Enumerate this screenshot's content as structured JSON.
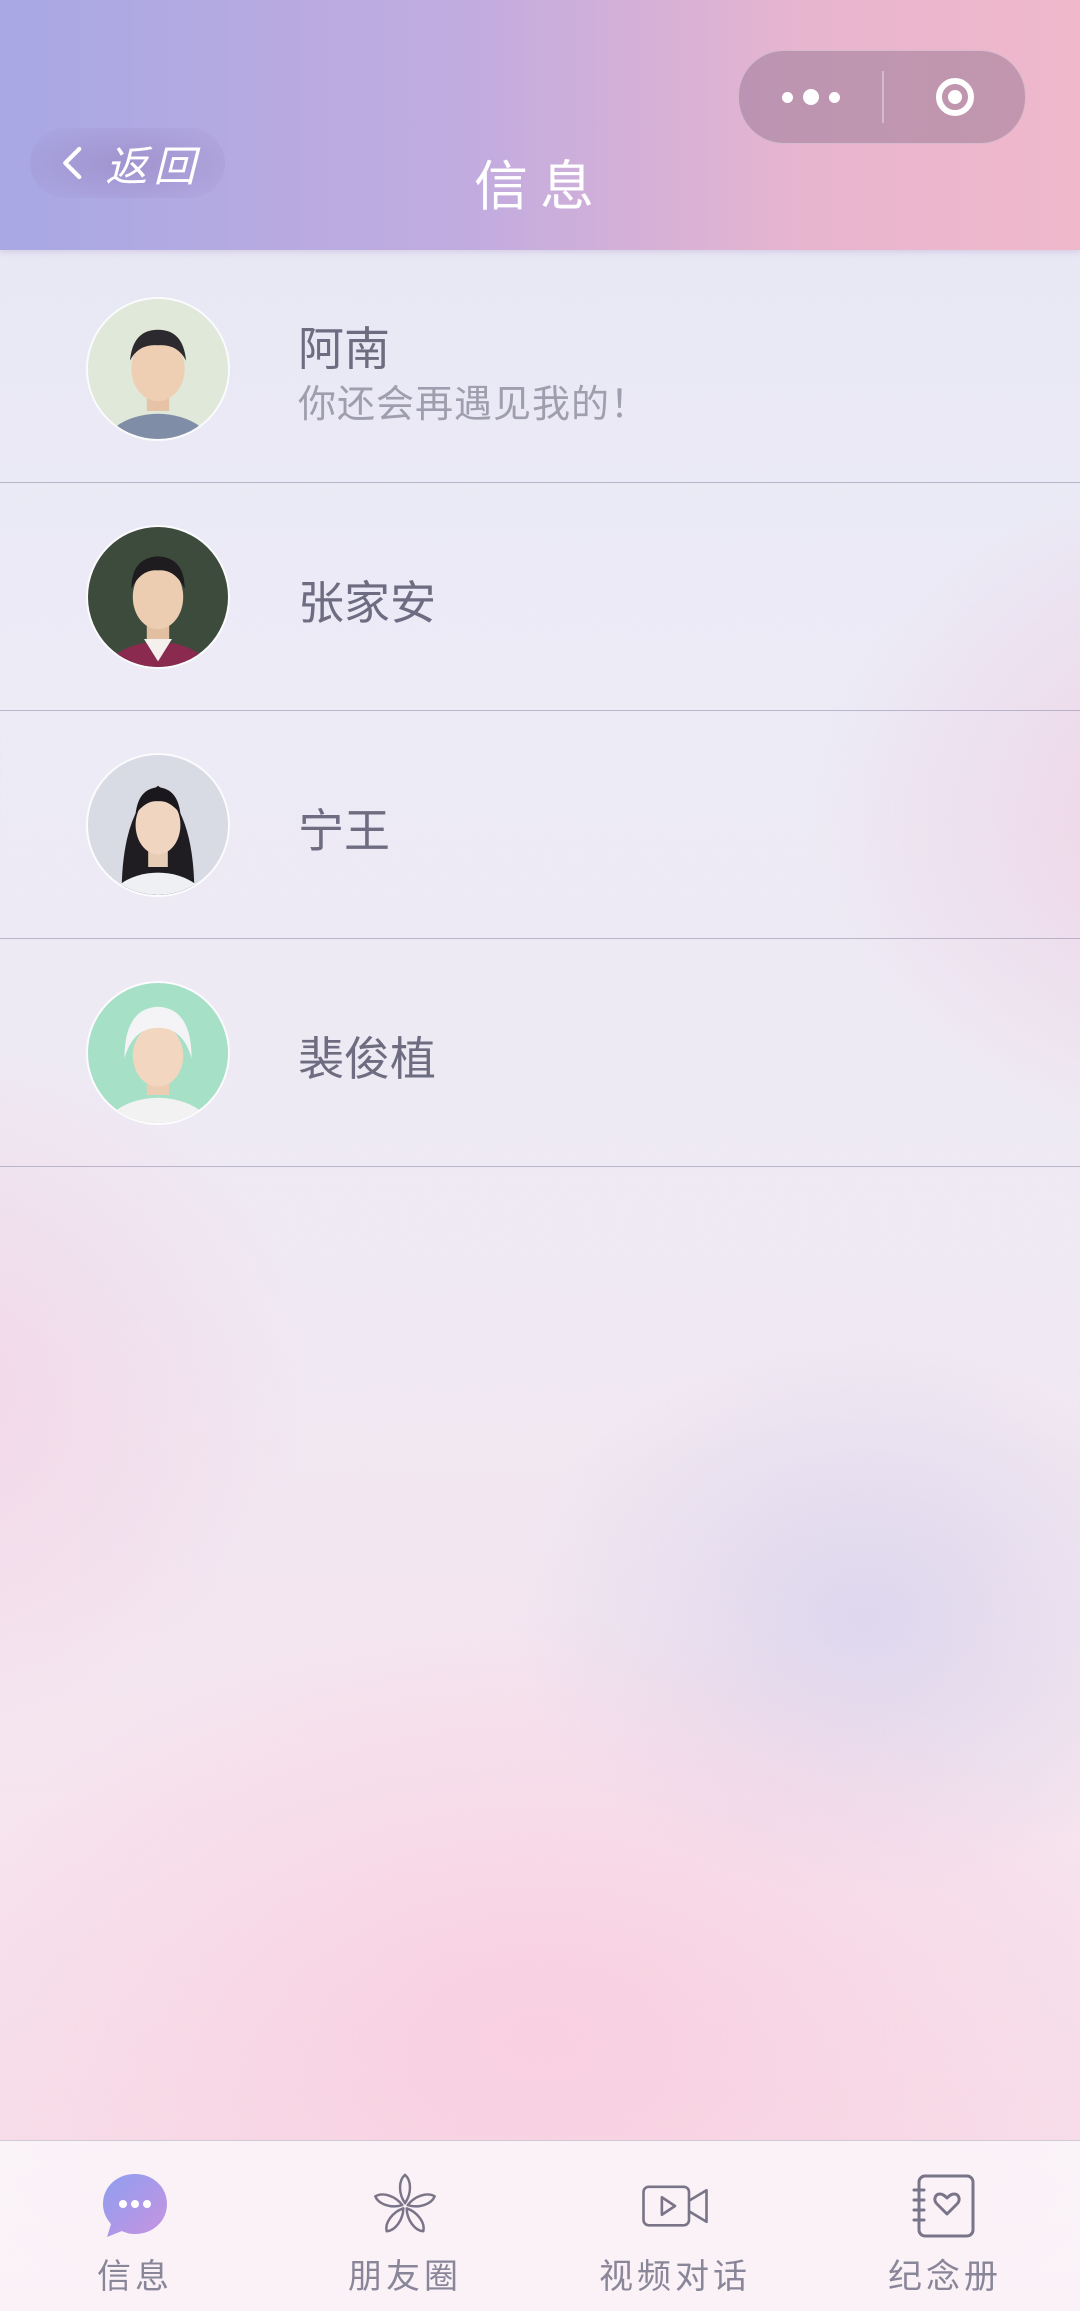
{
  "header": {
    "back_label": "返回",
    "title": "信息"
  },
  "contacts": [
    {
      "name": "阿南",
      "last_message": "你还会再遇见我的！"
    },
    {
      "name": "张家安"
    },
    {
      "name": "宁王"
    },
    {
      "name": "裴俊植"
    }
  ],
  "tabbar": {
    "tabs": [
      {
        "label": "信息",
        "icon": "chat-bubble-icon",
        "active": true
      },
      {
        "label": "朋友圈",
        "icon": "flower-icon"
      },
      {
        "label": "视频对话",
        "icon": "video-camera-icon"
      },
      {
        "label": "纪念册",
        "icon": "album-heart-icon"
      }
    ]
  },
  "colors": {
    "accent": "#a99ce6",
    "header_left": "#a8a8e4",
    "header_right": "#f0b8cb",
    "text_primary": "#6e6c80",
    "text_secondary": "#9f9eae"
  }
}
